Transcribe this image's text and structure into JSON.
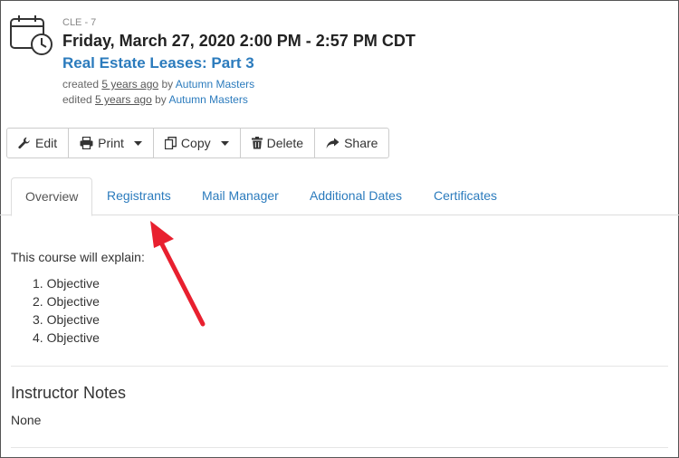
{
  "event": {
    "code": "CLE - 7",
    "datetime": "Friday, March 27, 2020 2:00 PM - 2:57 PM CDT",
    "title": "Real Estate Leases: Part 3",
    "created_prefix": "created",
    "created_ago": "5 years ago",
    "created_by": "by",
    "created_author": "Autumn Masters",
    "edited_prefix": "edited",
    "edited_ago": "5 years ago",
    "edited_by": "by",
    "edited_author": "Autumn Masters"
  },
  "toolbar": {
    "edit_label": "Edit",
    "print_label": "Print",
    "copy_label": "Copy",
    "delete_label": "Delete",
    "share_label": "Share"
  },
  "tabs": [
    {
      "label": "Overview",
      "active": true
    },
    {
      "label": "Registrants",
      "active": false
    },
    {
      "label": "Mail Manager",
      "active": false
    },
    {
      "label": "Additional Dates",
      "active": false
    },
    {
      "label": "Certificates",
      "active": false
    }
  ],
  "overview": {
    "intro": "This course will explain:",
    "objectives": [
      "1. Objective",
      "2. Objective",
      "3. Objective",
      "4. Objective"
    ]
  },
  "instructor_notes": {
    "heading": "Instructor Notes",
    "value": "None"
  },
  "colors": {
    "link": "#2b7bbd",
    "arrow": "#e8202f",
    "text": "#333333"
  },
  "icons": [
    "calendar-clock-icon",
    "wrench-icon",
    "printer-icon",
    "copy-icon",
    "trash-icon",
    "share-icon",
    "chevron-down-icon"
  ]
}
